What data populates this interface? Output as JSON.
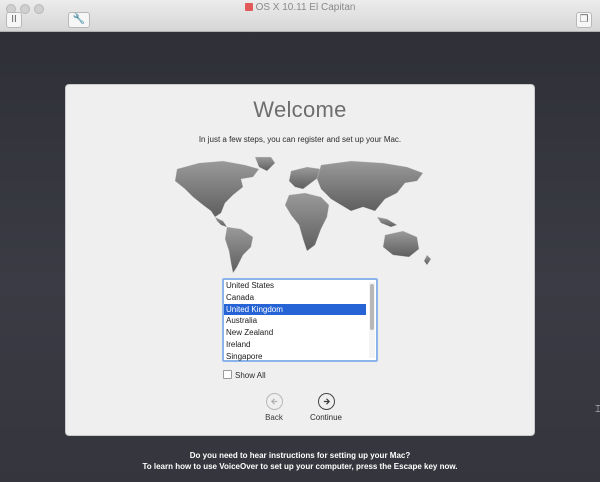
{
  "window": {
    "title": "OS X 10.11 El Capitan"
  },
  "toolbar": {
    "pause_label": "II",
    "settings_label": "🔧",
    "window_label": "❐"
  },
  "panel": {
    "title": "Welcome",
    "subtitle": "In just a few steps, you can register and set up your Mac.",
    "countries": [
      "United States",
      "Canada",
      "United Kingdom",
      "Australia",
      "New Zealand",
      "Ireland",
      "Singapore"
    ],
    "selected_country": "United Kingdom",
    "show_all_label": "Show All",
    "back_label": "Back",
    "continue_label": "Continue"
  },
  "footer": {
    "line1": "Do you need to hear instructions for setting up your Mac?",
    "line2": "To learn how to use VoiceOver to set up your computer, press the Escape key now."
  },
  "colors": {
    "selection": "#2663d4",
    "focus_ring": "#8cb4ec",
    "desktop": "#35353d"
  }
}
